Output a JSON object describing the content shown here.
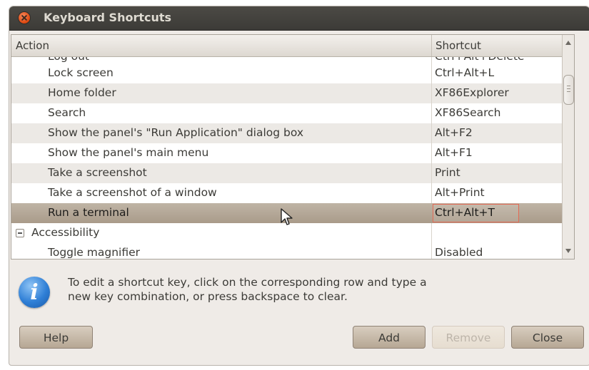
{
  "window": {
    "title": "Keyboard Shortcuts"
  },
  "list": {
    "columns": {
      "action": "Action",
      "shortcut": "Shortcut"
    },
    "partial_top": {
      "action": "Log out",
      "shortcut": "Ctrl+Alt+Delete"
    },
    "rows": [
      {
        "action": "Lock screen",
        "shortcut": "Ctrl+Alt+L"
      },
      {
        "action": "Home folder",
        "shortcut": "XF86Explorer"
      },
      {
        "action": "Search",
        "shortcut": "XF86Search"
      },
      {
        "action": "Show the panel's \"Run Application\" dialog box",
        "shortcut": "Alt+F2"
      },
      {
        "action": "Show the panel's main menu",
        "shortcut": "Alt+F1"
      },
      {
        "action": "Take a screenshot",
        "shortcut": "Print"
      },
      {
        "action": "Take a screenshot of a window",
        "shortcut": "Alt+Print"
      },
      {
        "action": "Run a terminal",
        "shortcut": "Ctrl+Alt+T"
      }
    ],
    "category": {
      "label": "Accessibility"
    },
    "partial_bottom": {
      "action": "Toggle magnifier",
      "shortcut": "Disabled"
    }
  },
  "info": {
    "text": "To edit a shortcut key, click on the corresponding row and type a new key combination, or press backspace to clear."
  },
  "buttons": {
    "help": "Help",
    "add": "Add",
    "remove": "Remove",
    "close": "Close"
  },
  "icons": {
    "close": "close-icon",
    "info": "info-icon",
    "expander": "collapse-icon",
    "cursor": "mouse-pointer-icon"
  }
}
